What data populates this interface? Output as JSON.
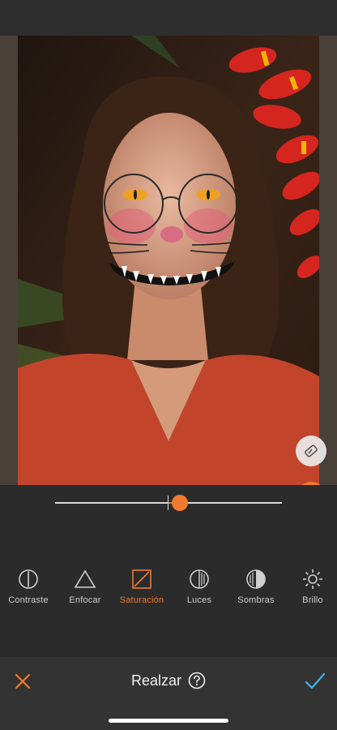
{
  "photo": {
    "subject": "portrait-with-halloween-face-paint"
  },
  "slider": {
    "value": 0.1
  },
  "tools": [
    {
      "label": "Contraste",
      "icon": "contrast-icon",
      "active": false
    },
    {
      "label": "Enfocar",
      "icon": "sharpen-triangle-icon",
      "active": false
    },
    {
      "label": "Saturación",
      "icon": "saturation-icon",
      "active": true
    },
    {
      "label": "Luces",
      "icon": "highlights-icon",
      "active": false
    },
    {
      "label": "Sombras",
      "icon": "shadows-icon",
      "active": false
    },
    {
      "label": "Brillo",
      "icon": "brightness-sun-icon",
      "active": false
    }
  ],
  "bottom_bar": {
    "title": "Realzar",
    "cancel_icon": "close-x-icon",
    "confirm_icon": "checkmark-icon",
    "help_icon": "help-question-icon"
  },
  "colors": {
    "accent": "#f07a2f",
    "confirm": "#3fb6e6",
    "background": "#2b2b2b",
    "bar": "#333333"
  }
}
